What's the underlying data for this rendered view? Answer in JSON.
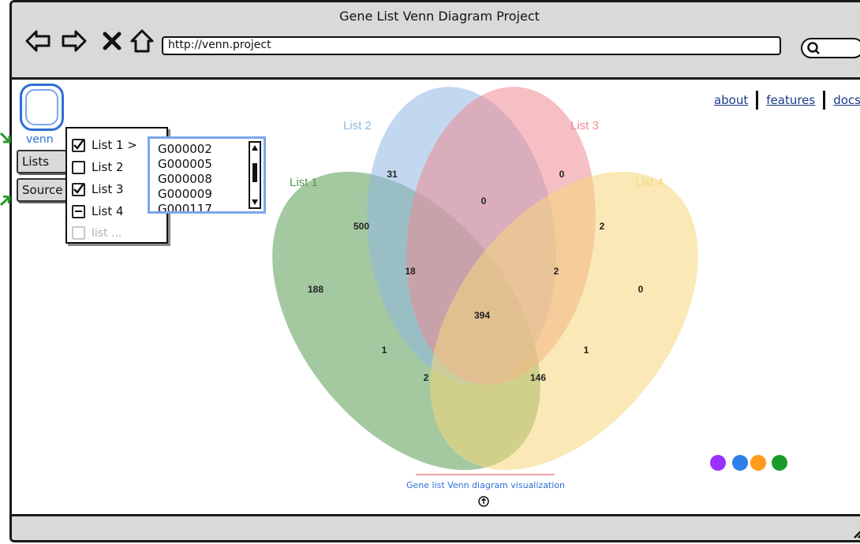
{
  "window": {
    "title": "Gene List Venn Diagram Project"
  },
  "browser": {
    "url": "http://venn.project"
  },
  "nav_links": [
    "about",
    "features",
    "docs"
  ],
  "app": {
    "logo_label": "venn"
  },
  "sidebar": {
    "buttons": [
      "Lists",
      "Source"
    ]
  },
  "menu": {
    "items": [
      {
        "label": "List 1 >",
        "state": "checked"
      },
      {
        "label": "List 2",
        "state": "unchecked"
      },
      {
        "label": "List 3",
        "state": "checked"
      },
      {
        "label": "List 4",
        "state": "indeterminate"
      },
      {
        "label": "list ...",
        "state": "disabled"
      }
    ]
  },
  "genes": [
    "G000002",
    "G000005",
    "G000008",
    "G000009",
    "G000117"
  ],
  "venn": {
    "sets": [
      {
        "name": "List 1",
        "color": "#5a9b52"
      },
      {
        "name": "List 2",
        "color": "#8fb8e3"
      },
      {
        "name": "List 3",
        "color": "#ef8a93"
      },
      {
        "name": "List 4",
        "color": "#f6d77a"
      }
    ],
    "region_counts": [
      "188",
      "500",
      "31",
      "0",
      "2",
      "0",
      "18",
      "0",
      "2",
      "394",
      "1",
      "1",
      "146",
      "2"
    ]
  },
  "caption": "Gene list Venn diagram visualization",
  "palette": [
    "#9b30ff",
    "#2f7fe8",
    "#ff9a1a",
    "#1a9a2a"
  ]
}
